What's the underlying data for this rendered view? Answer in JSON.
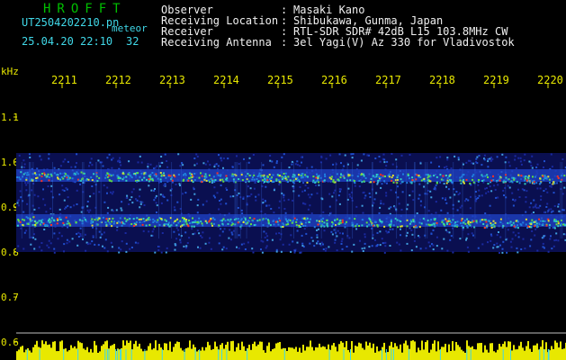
{
  "header": {
    "brand": "HROFFT",
    "file_name": "UT2504202210.pn",
    "file_suffix": "meteor",
    "datetime": "25.04.20 22:10",
    "number": "32"
  },
  "info": [
    {
      "label": "Observer",
      "value": "Masaki Kano"
    },
    {
      "label": "Receiving Location",
      "value": "Shibukawa, Gunma, Japan"
    },
    {
      "label": "Receiver",
      "value": "RTL-SDR SDR# 42dB L15 103.8MHz CW"
    },
    {
      "label": "Receiving Antenna",
      "value": "3el Yagi(V) Az 330 for Vladivostok"
    }
  ],
  "axis": {
    "y_unit": "kHz",
    "y_labels": [
      "1.1",
      "1.0",
      "0.9",
      "0.8",
      "0.7",
      "0.6"
    ],
    "time_labels": [
      "2211",
      "2212",
      "2213",
      "2214",
      "2215",
      "2216",
      "2217",
      "2218",
      "2219",
      "2220"
    ]
  },
  "colors": {
    "background": "#000000",
    "brand": "#00c000",
    "header_text": "#40d8e8",
    "info_text": "#f0f0f0",
    "axis_text": "#e8e800",
    "baseline": "#e8e800",
    "signal_low": "#1a2aa0",
    "signal_high": "#ff3020"
  },
  "spectrogram": {
    "bands_khz": [
      0.97,
      0.87
    ],
    "band_range_khz": [
      0.8,
      1.02
    ]
  }
}
